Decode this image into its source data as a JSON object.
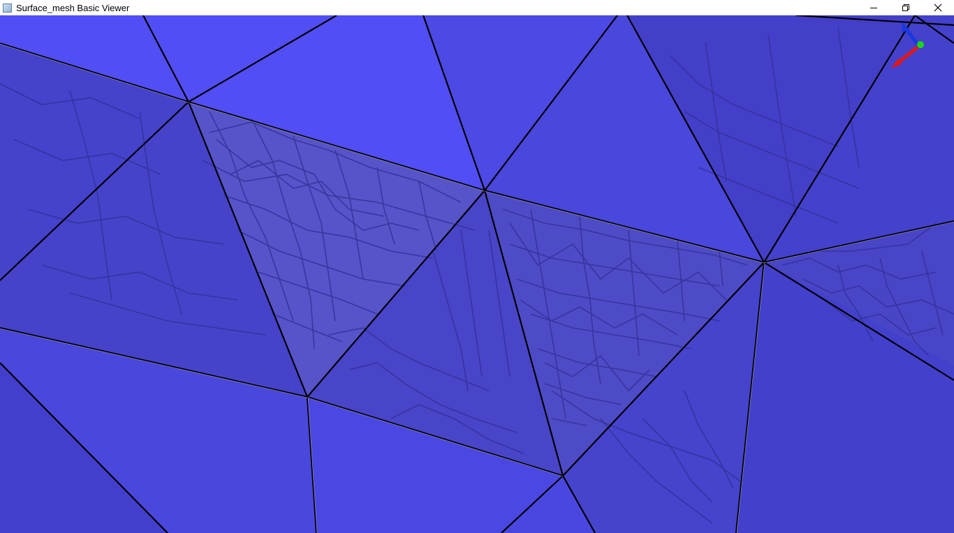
{
  "window": {
    "title": "Surface_mesh Basic Viewer"
  },
  "controls": {
    "minimize_icon": "minimize-icon",
    "restore_icon": "restore-icon",
    "close_icon": "close-icon"
  },
  "viewer": {
    "colors": {
      "face_bright": "#524ef5",
      "face_mid": "#4a47dc",
      "face_dark": "#3f3cc4",
      "face_transparent": "#5753c9",
      "inner_edge": "#33319a",
      "outer_edge": "#000000",
      "axis_x": "#e01818",
      "axis_y": "#18d818",
      "axis_z": "#1838e0"
    }
  }
}
